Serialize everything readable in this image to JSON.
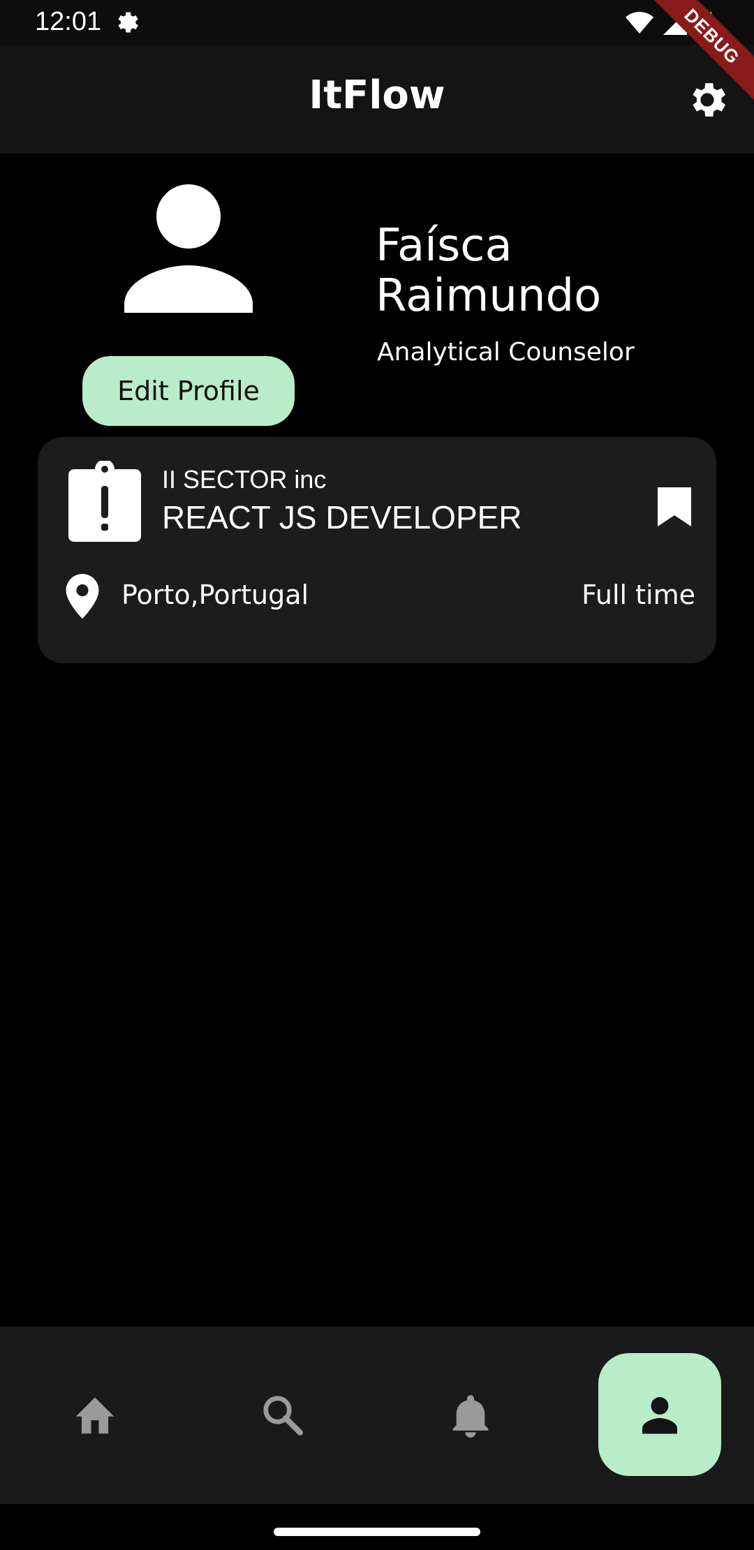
{
  "status_bar": {
    "time": "12:01"
  },
  "debug_banner": "DEBUG",
  "app_bar": {
    "title": "ItFlow"
  },
  "profile": {
    "name": "Faísca Raimundo",
    "role": "Analytical Counselor",
    "edit_button_label": "Edit Profile"
  },
  "job_card": {
    "company": "II SECTOR inc",
    "title": "REACT JS DEVELOPER",
    "location": "Porto,Portugal",
    "type": "Full time"
  },
  "bottom_nav": {
    "items": [
      "home",
      "search",
      "notifications",
      "profile"
    ],
    "active": "profile"
  },
  "colors": {
    "accent": "#b9edc9",
    "background": "#000000",
    "app_bar": "#141414",
    "card": "#1c1c1c",
    "nav": "#1a1a1a",
    "inactive_icon": "#9a9a9a"
  }
}
